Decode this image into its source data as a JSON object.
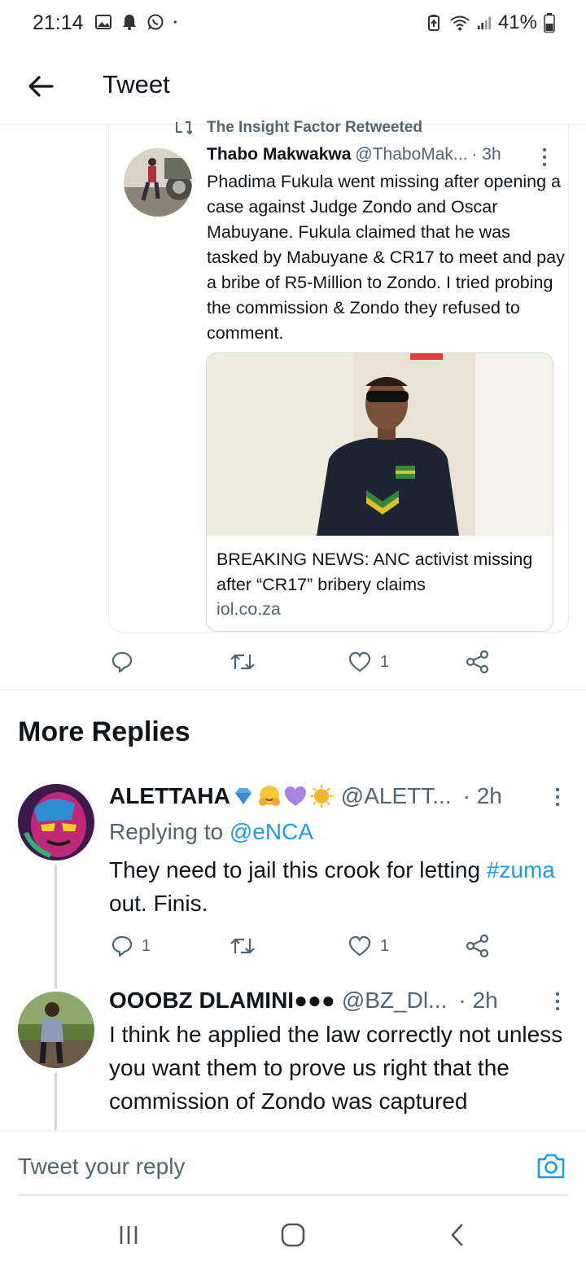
{
  "status_bar": {
    "time": "21:14",
    "battery": "41%",
    "icons_left": [
      "gallery-icon",
      "alarm-icon",
      "whatsapp-icon",
      "dot-icon"
    ],
    "icons_right": [
      "battery-saver-icon",
      "wifi-icon",
      "signal-icon",
      "battery-icon"
    ]
  },
  "header": {
    "title": "Tweet",
    "back_icon": "arrow-left-icon"
  },
  "quoted_tweet": {
    "retweet_label": "The Insight Factor Retweeted",
    "author_name": "Thabo Makwakwa",
    "author_handle": "@ThaboMak...",
    "time": "· 3h",
    "text": "Phadima Fukula went missing after opening a case against Judge Zondo and Oscar Mabuyane. Fukula claimed that he was tasked by Mabuyane & CR17 to meet and pay a bribe of R5-Million to Zondo. I tried probing the commission & Zondo they refused to comment.",
    "link_card": {
      "title": "BREAKING NEWS: ANC activist missing after “CR17” bribery claims",
      "domain": "iol.co.za"
    },
    "actions": {
      "reply_count": "",
      "retweet_count": "",
      "like_count": "1"
    }
  },
  "section": {
    "title": "More Replies"
  },
  "replies": [
    {
      "author_name": "ALETTAHA",
      "emojis": [
        "gem-emoji",
        "hugging-face-emoji",
        "purple-heart-emoji",
        "sun-emoji"
      ],
      "author_handle": "@ALETT...",
      "time": "· 2h",
      "replying_prefix": "Replying to",
      "replying_to": "@eNCA",
      "text_before": "They need to jail this crook for letting ",
      "hashtag": "#zuma",
      "text_after": " out. Finis.",
      "actions": {
        "reply_count": "1",
        "retweet_count": "",
        "like_count": "1"
      }
    },
    {
      "author_name": "OOOBZ DLAMINI●●●",
      "author_handle": "@BZ_Dl...",
      "time": "· 2h",
      "text": "I think he applied the law correctly not unless you want them to prove us right that the commission of Zondo was captured"
    }
  ],
  "composer": {
    "placeholder": "Tweet your reply",
    "camera_icon": "camera-icon"
  },
  "nav": {
    "recents_icon": "recents-icon",
    "home_icon": "home-icon",
    "back_icon": "back-icon"
  },
  "colors": {
    "accent": "#1d9bf0",
    "text": "#0f1419",
    "muted": "#536471",
    "border": "#e7e9ea"
  }
}
